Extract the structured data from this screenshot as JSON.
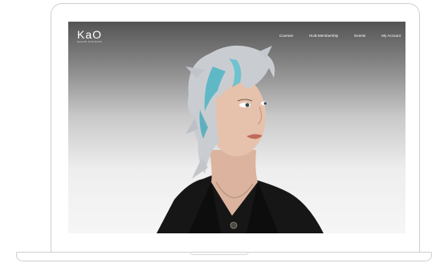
{
  "brand": {
    "name": "KaO",
    "tagline": "SALON DIVISION"
  },
  "nav": {
    "items": [
      {
        "label": "Courses"
      },
      {
        "label": "HUB Membership"
      },
      {
        "label": "Events"
      },
      {
        "label": "My Account"
      }
    ]
  },
  "colors": {
    "hair_accent": "#5fb8c6",
    "jacket": "#151515",
    "header_gradient_top": "#545454"
  }
}
